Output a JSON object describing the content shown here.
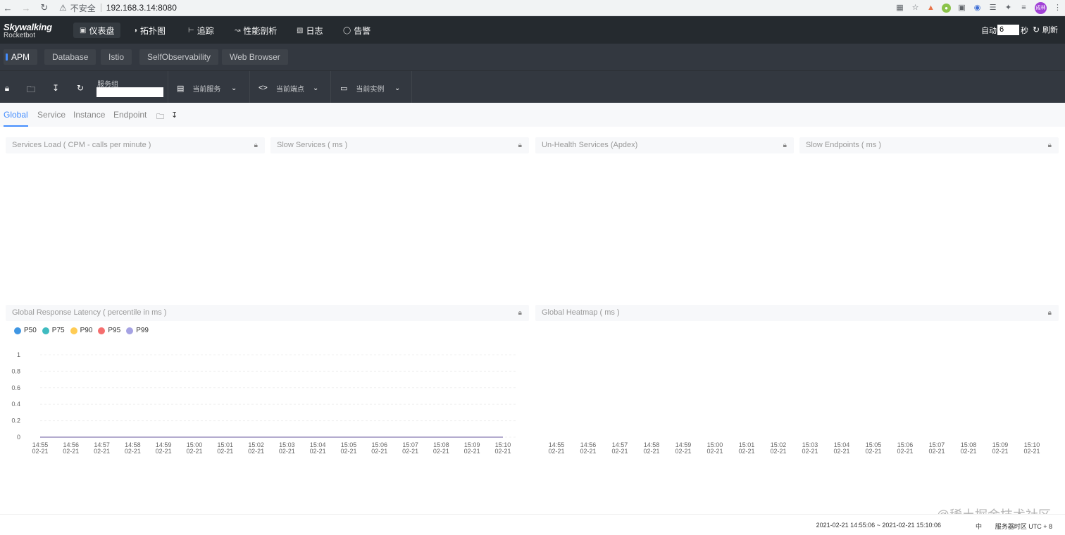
{
  "browser": {
    "security_label": "不安全",
    "url": "192.168.3.14:8080",
    "avatar_text": "成林"
  },
  "app": {
    "logo_line1": "Skywalking",
    "logo_line2": "Rocketbot",
    "nav": [
      {
        "label": "仪表盘",
        "icon": "dashboard-icon"
      },
      {
        "label": "拓扑图",
        "icon": "topology-icon"
      },
      {
        "label": "追踪",
        "icon": "trace-icon"
      },
      {
        "label": "性能剖析",
        "icon": "profile-icon"
      },
      {
        "label": "日志",
        "icon": "log-icon"
      },
      {
        "label": "告警",
        "icon": "alarm-icon"
      }
    ],
    "auto_label": "自动",
    "auto_value": "6",
    "seconds_label": "秒",
    "refresh_label": "刷新"
  },
  "layers": [
    "APM",
    "Database",
    "Istio",
    "SelfObservability",
    "Web Browser"
  ],
  "toolbar": {
    "service_group_label": "服务组",
    "current_service": "当前服务",
    "current_endpoint": "当前端点",
    "current_instance": "当前实例"
  },
  "dashboard_tabs": [
    "Global",
    "Service",
    "Instance",
    "Endpoint"
  ],
  "panels": {
    "services_load": "Services Load ( CPM - calls per minute )",
    "slow_services": "Slow Services ( ms )",
    "unhealth_services": "Un-Health Services (Apdex)",
    "slow_endpoints": "Slow Endpoints ( ms )",
    "latency": "Global Response Latency ( percentile in ms )",
    "heatmap": "Global Heatmap ( ms )"
  },
  "chart_data": [
    {
      "type": "line",
      "title": "Global Response Latency ( percentile in ms )",
      "categories": [
        "14:55\n02-21",
        "14:56\n02-21",
        "14:57\n02-21",
        "14:58\n02-21",
        "14:59\n02-21",
        "15:00\n02-21",
        "15:01\n02-21",
        "15:02\n02-21",
        "15:03\n02-21",
        "15:04\n02-21",
        "15:05\n02-21",
        "15:06\n02-21",
        "15:07\n02-21",
        "15:08\n02-21",
        "15:09\n02-21",
        "15:10\n02-21"
      ],
      "ylim": [
        0,
        1
      ],
      "yticks": [
        0,
        0.2,
        0.4,
        0.6,
        0.8,
        1
      ],
      "legend_position": "top-left",
      "series": [
        {
          "name": "P50",
          "color": "#3f96e3",
          "values": [
            0,
            0,
            0,
            0,
            0,
            0,
            0,
            0,
            0,
            0,
            0,
            0,
            0,
            0,
            0,
            0
          ]
        },
        {
          "name": "P75",
          "color": "#3fbbc0",
          "values": [
            0,
            0,
            0,
            0,
            0,
            0,
            0,
            0,
            0,
            0,
            0,
            0,
            0,
            0,
            0,
            0
          ]
        },
        {
          "name": "P90",
          "color": "#ffcc55",
          "values": [
            0,
            0,
            0,
            0,
            0,
            0,
            0,
            0,
            0,
            0,
            0,
            0,
            0,
            0,
            0,
            0
          ]
        },
        {
          "name": "P95",
          "color": "#f56e6e",
          "values": [
            0,
            0,
            0,
            0,
            0,
            0,
            0,
            0,
            0,
            0,
            0,
            0,
            0,
            0,
            0,
            0
          ]
        },
        {
          "name": "P99",
          "color": "#a5a2e3",
          "values": [
            0,
            0,
            0,
            0,
            0,
            0,
            0,
            0,
            0,
            0,
            0,
            0,
            0,
            0,
            0,
            0
          ]
        }
      ]
    },
    {
      "type": "heatmap",
      "title": "Global Heatmap ( ms )",
      "categories": [
        "14:55\n02-21",
        "14:56\n02-21",
        "14:57\n02-21",
        "14:58\n02-21",
        "14:59\n02-21",
        "15:00\n02-21",
        "15:01\n02-21",
        "15:02\n02-21",
        "15:03\n02-21",
        "15:04\n02-21",
        "15:05\n02-21",
        "15:06\n02-21",
        "15:07\n02-21",
        "15:08\n02-21",
        "15:09\n02-21",
        "15:10\n02-21"
      ],
      "values": []
    }
  ],
  "footer": {
    "time_range": "2021-02-21 14:55:06 ~ 2021-02-21 15:10:06",
    "language": "中",
    "timezone": "服务器时区 UTC + 8"
  },
  "watermark": "@稀土掘金技术社区"
}
